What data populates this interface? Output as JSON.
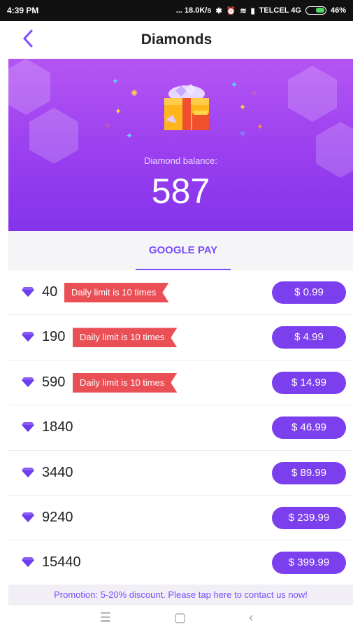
{
  "status_bar": {
    "time": "4:39 PM",
    "network": "... 18.0K/s",
    "carrier": "TELCEL 4G",
    "battery": "46%"
  },
  "header": {
    "title": "Diamonds"
  },
  "hero": {
    "balance_label": "Diamond balance:",
    "balance": "587"
  },
  "payment": {
    "tab_label": "GOOGLE PAY"
  },
  "packages": [
    {
      "amount": "40",
      "limit": "Daily limit is 10 times",
      "price": "$ 0.99"
    },
    {
      "amount": "190",
      "limit": "Daily limit is 10 times",
      "price": "$ 4.99"
    },
    {
      "amount": "590",
      "limit": "Daily limit is 10 times",
      "price": "$ 14.99"
    },
    {
      "amount": "1840",
      "limit": "",
      "price": "$ 46.99"
    },
    {
      "amount": "3440",
      "limit": "",
      "price": "$ 89.99"
    },
    {
      "amount": "9240",
      "limit": "",
      "price": "$ 239.99"
    },
    {
      "amount": "15440",
      "limit": "",
      "price": "$ 399.99"
    }
  ],
  "promo": {
    "text": "Promotion: 5-20% discount. Please tap here to contact us now!"
  },
  "colors": {
    "accent": "#7b3fed",
    "limit_badge": "#ea4f55",
    "hero_top": "#b455f2",
    "hero_bottom": "#8433ea"
  }
}
